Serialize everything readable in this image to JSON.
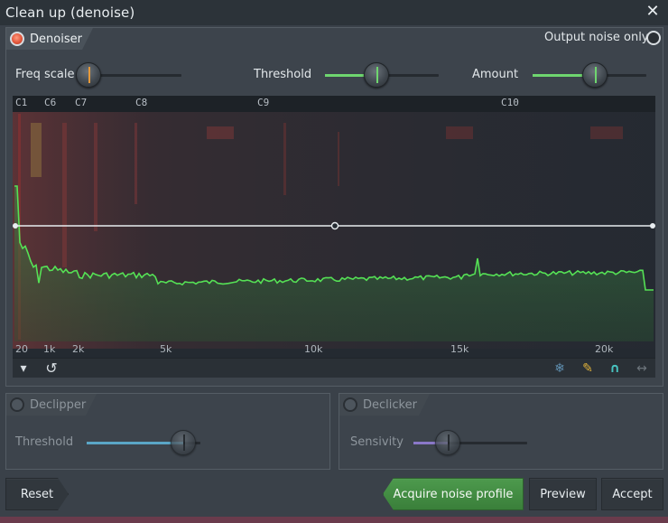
{
  "window": {
    "title": "Clean up (denoise)"
  },
  "icons": {
    "close": "✕",
    "dropdown": "▾",
    "undo": "↺",
    "freeze": "❄",
    "pencil": "✎",
    "magnet": "∩",
    "swap": "↔"
  },
  "colors": {
    "accent_green": "#6fd66f",
    "acquire_button": "#3f8a3f",
    "led_on": "#e3573c"
  },
  "denoiser": {
    "label": "Denoiser",
    "enabled": true,
    "output_noise_only_label": "Output noise only",
    "freq_scale_label": "Freq scale",
    "threshold_label": "Threshold",
    "amount_label": "Amount",
    "threshold_level": 0.45,
    "amount_level": 0.55
  },
  "spectrum": {
    "note_labels": [
      "C1",
      "C6",
      "C7",
      "C8",
      "C9",
      "C10"
    ],
    "freq_labels": [
      "20",
      "1k",
      "2k",
      "5k",
      "10k",
      "15k",
      "20k"
    ]
  },
  "declipper": {
    "label": "Declipper",
    "enabled": false,
    "threshold_label": "Threshold",
    "threshold_level": 0.85
  },
  "declicker": {
    "label": "Declicker",
    "enabled": false,
    "sensivity_label": "Sensivity",
    "sensivity_level": 0.3
  },
  "buttons": {
    "reset": "Reset",
    "acquire": "Acquire noise profile",
    "preview": "Preview",
    "accept": "Accept"
  }
}
